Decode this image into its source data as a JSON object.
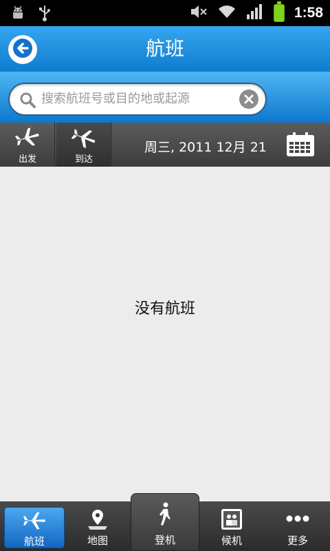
{
  "status": {
    "time": "1:58",
    "icons": [
      "android-debug-icon",
      "usb-icon",
      "mute-icon",
      "wifi-icon",
      "signal-icon",
      "battery-icon"
    ]
  },
  "header": {
    "title": "航班",
    "back_icon": "back-arrow-icon"
  },
  "search": {
    "placeholder": "搜索航班号或目的地或起源"
  },
  "filter": {
    "departure_label": "出发",
    "arrival_label": "到达",
    "date": "周三, 2011 12月  21"
  },
  "main": {
    "empty_message": "没有航班"
  },
  "nav": {
    "items": [
      {
        "label": "航班",
        "icon": "airplane-icon",
        "active": true
      },
      {
        "label": "地图",
        "icon": "map-pin-icon",
        "active": false
      },
      {
        "label": "登机",
        "icon": "walking-person-icon",
        "active": false
      },
      {
        "label": "候机",
        "icon": "lounge-icon",
        "active": false
      },
      {
        "label": "更多",
        "icon": "more-icon",
        "active": false
      }
    ]
  },
  "colors": {
    "header_blue": "#1d8ee0",
    "active_tab": "#2a86dc",
    "content_bg": "#ececec"
  }
}
